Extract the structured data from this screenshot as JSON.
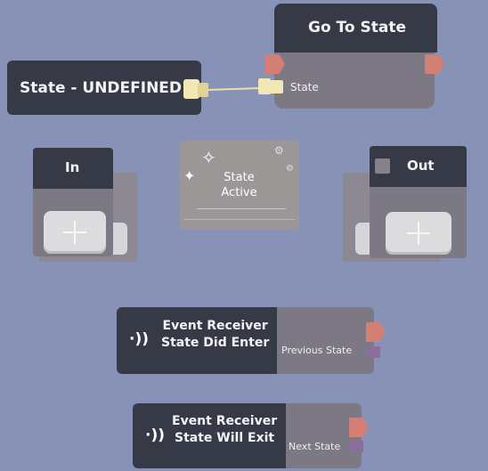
{
  "state_undefined_node": {
    "label": "State - UNDEFINED"
  },
  "go_to_state_node": {
    "title": "Go To State",
    "input_label": "State"
  },
  "in_node": {
    "title": "In"
  },
  "state_active_node": {
    "line1": "State",
    "line2": "Active"
  },
  "out_node": {
    "title": "Out"
  },
  "event_enter_node": {
    "title_line1": "Event Receiver",
    "title_line2": "State Did Enter",
    "port_label": "Previous State"
  },
  "event_exit_node": {
    "title_line1": "Event Receiver",
    "title_line2": "State Will Exit",
    "port_label": "Next State"
  },
  "colors": {
    "background": "#8792b6",
    "node_header": "#363a47",
    "node_body": "#7c7884",
    "exec_port": "#d47f74",
    "data_port": "#8b6e9c",
    "wire": "#e9dfa6"
  }
}
